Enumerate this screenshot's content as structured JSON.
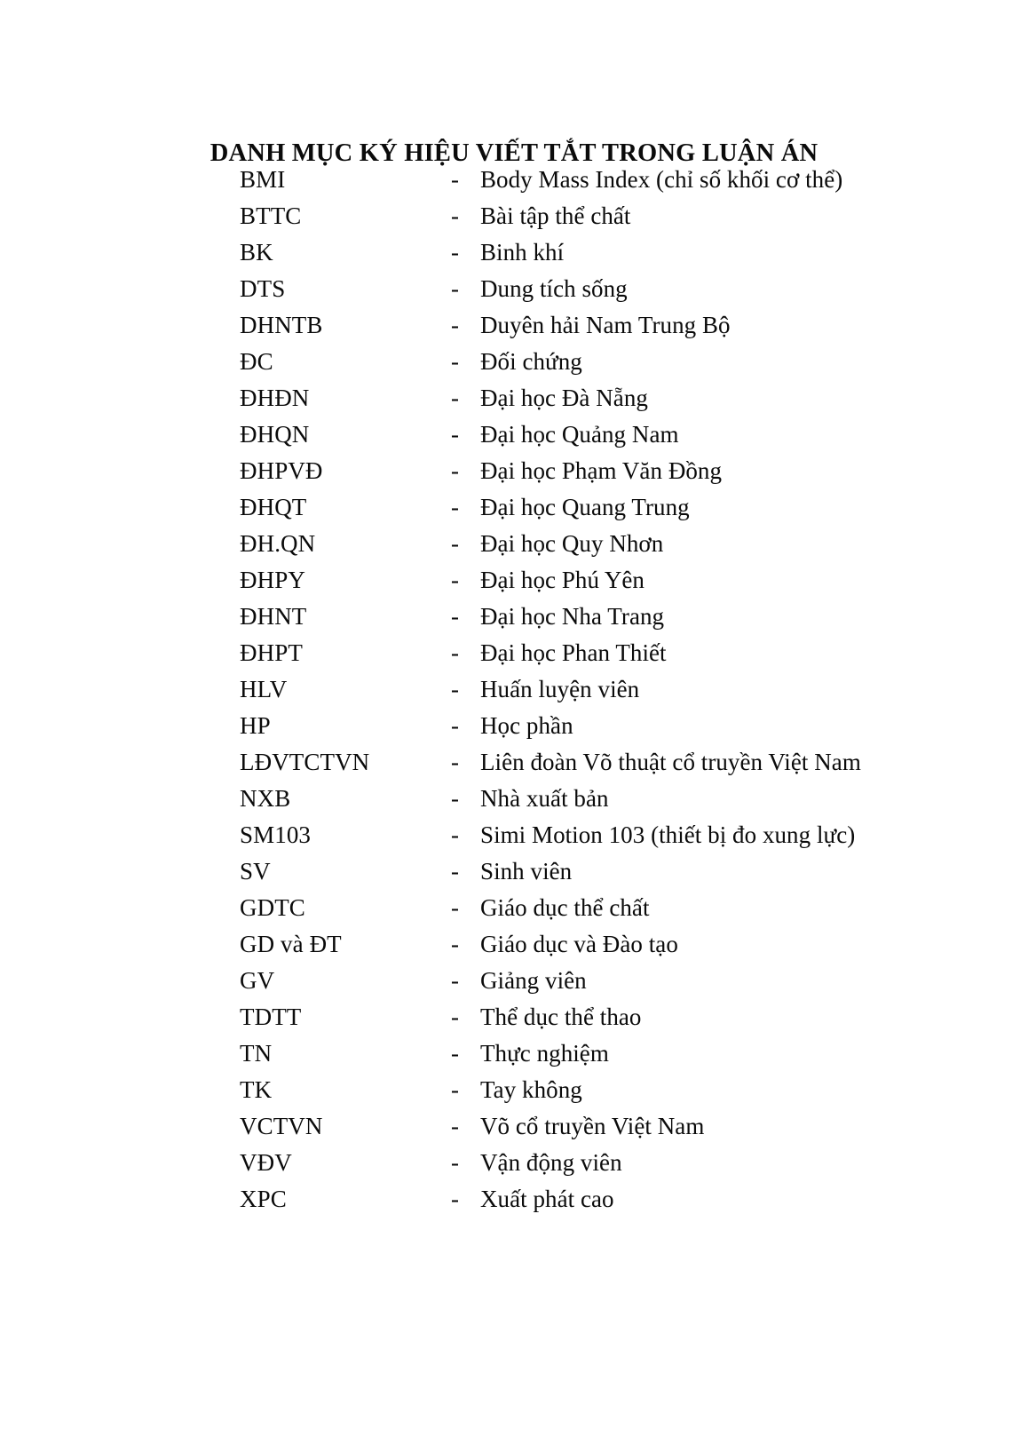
{
  "document": {
    "title": "DANH MỤC KÝ HIỆU VIẾT TẮT TRONG LUẬN ÁN",
    "separator": "-",
    "entries": [
      {
        "term": "BMI",
        "definition": "Body Mass Index (chỉ số khối cơ thể)"
      },
      {
        "term": "BTTC",
        "definition": "Bài tập thể chất"
      },
      {
        "term": "BK",
        "definition": "Binh khí"
      },
      {
        "term": "DTS",
        "definition": "Dung tích sống"
      },
      {
        "term": "DHNTB",
        "definition": "Duyên hải Nam Trung Bộ"
      },
      {
        "term": "ĐC",
        "definition": "Đối chứng"
      },
      {
        "term": "ĐHĐN",
        "definition": "Đại học Đà Nẵng"
      },
      {
        "term": "ĐHQN",
        "definition": "Đại học Quảng Nam"
      },
      {
        "term": "ĐHPVĐ",
        "definition": "Đại học Phạm Văn Đồng"
      },
      {
        "term": "ĐHQT",
        "definition": "Đại học Quang Trung"
      },
      {
        "term": "ĐH.QN",
        "definition": "Đại học Quy Nhơn"
      },
      {
        "term": "ĐHPY",
        "definition": "Đại học Phú Yên"
      },
      {
        "term": "ĐHNT",
        "definition": "Đại học Nha Trang"
      },
      {
        "term": "ĐHPT",
        "definition": "Đại học Phan Thiết"
      },
      {
        "term": "HLV",
        "definition": "Huấn luyện viên"
      },
      {
        "term": "HP",
        "definition": "Học phần"
      },
      {
        "term": "LĐVTCTVN",
        "definition": "Liên đoàn Võ thuật cổ truyền Việt Nam"
      },
      {
        "term": "NXB",
        "definition": "Nhà xuất bản"
      },
      {
        "term": "SM103",
        "definition": "Simi Motion 103 (thiết bị đo xung lực)"
      },
      {
        "term": "SV",
        "definition": "Sinh viên"
      },
      {
        "term": "GDTC",
        "definition": "Giáo dục thể chất"
      },
      {
        "term": "GD và ĐT",
        "definition": "Giáo dục và Đào tạo"
      },
      {
        "term": "GV",
        "definition": "Giảng viên"
      },
      {
        "term": "TDTT",
        "definition": "Thể dục thể thao"
      },
      {
        "term": "TN",
        "definition": "Thực nghiệm"
      },
      {
        "term": "TK",
        "definition": "Tay không"
      },
      {
        "term": "VCTVN",
        "definition": "Võ cổ truyền Việt Nam"
      },
      {
        "term": "VĐV",
        "definition": "Vận động viên"
      },
      {
        "term": "XPC",
        "definition": "Xuất phát cao"
      }
    ]
  },
  "colors": {
    "page_background": "#ffffff",
    "text": "#0b0b0b"
  }
}
